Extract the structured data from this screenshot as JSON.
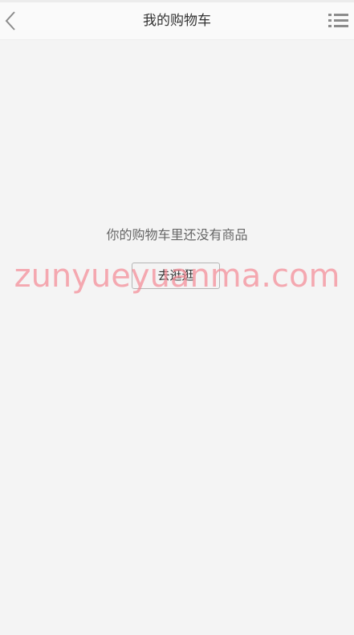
{
  "header": {
    "title": "我的购物车",
    "back_icon": "chevron-left-icon",
    "menu_icon": "list-menu-icon"
  },
  "empty_state": {
    "message": "你的购物车里还没有商品",
    "button_label": "去逛逛"
  },
  "watermark": {
    "text": "zunyueyuanma.com"
  },
  "colors": {
    "background": "#f4f4f4",
    "header_bg": "#fafafa",
    "icon_gray": "#8c8c8c",
    "watermark": "#f48a96"
  }
}
